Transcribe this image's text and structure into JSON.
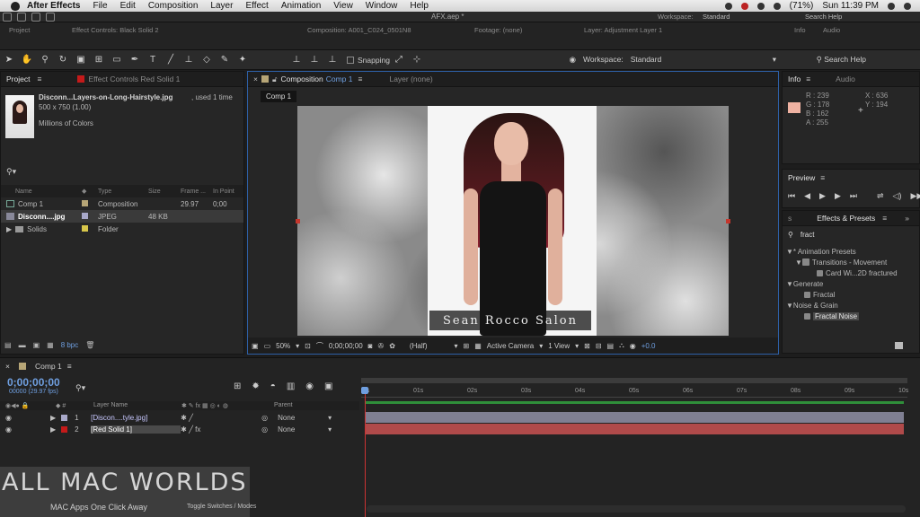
{
  "menubar": {
    "app": "After Effects",
    "items": [
      "File",
      "Edit",
      "Composition",
      "Layer",
      "Effect",
      "Animation",
      "View",
      "Window",
      "Help"
    ],
    "battery": "(71%)",
    "clock": "Sun 11:39 PM"
  },
  "oldbar": {
    "title": "AFX.aep *",
    "workspace_label": "Workspace:",
    "workspace_value": "Standard",
    "search": "Search Help",
    "tabs": [
      "Project",
      "Effect Controls: Black Solid 2",
      "Composition: A001_C024_0501N8",
      "Footage: (none)",
      "Layer: Adjustment Layer 1",
      "Info",
      "Audio"
    ]
  },
  "toolbar": {
    "snapping": "Snapping",
    "workspace_label": "Workspace:",
    "workspace_value": "Standard",
    "search_help": "Search Help"
  },
  "project": {
    "tab": "Project",
    "effect_tab": "Effect Controls Red Solid 1",
    "file_name": "Disconn...Layers-on-Long-Hairstyle.jpg",
    "used": ", used 1 time",
    "dims": "500 x 750 (1.00)",
    "colors": "Millions of Colors",
    "columns": [
      "Name",
      "Type",
      "Size",
      "Frame ...",
      "In Point"
    ],
    "rows": [
      {
        "name": "Comp 1",
        "type": "Composition",
        "size": "",
        "frame": "29.97",
        "in": "0;00",
        "color": "#b7a677"
      },
      {
        "name": "Disconn....jpg",
        "type": "JPEG",
        "size": "48 KB",
        "frame": "",
        "in": "",
        "color": "#a9a9c9"
      },
      {
        "name": "Solids",
        "type": "Folder",
        "size": "",
        "frame": "",
        "in": "",
        "color": "#d7c64a"
      }
    ],
    "bpc": "8 bpc"
  },
  "comp": {
    "tab": "Composition",
    "tab_comp": "Comp 1",
    "layer_tab": "Layer (none)",
    "breadcrumb": "Comp 1",
    "salon": "Sean Rocco Salon",
    "zoom": "50%",
    "timecode": "0;00;00;00",
    "resolution": "(Half)",
    "camera": "Active Camera",
    "view": "1 View",
    "exposure": "+0.0"
  },
  "info": {
    "tab": "Info",
    "audio_tab": "Audio",
    "r": "R : 239",
    "g": "G : 178",
    "b": "B : 162",
    "a": "A : 255",
    "x": "X : 636",
    "y": "Y : 194",
    "swatch": "#efb2a2"
  },
  "preview": {
    "title": "Preview"
  },
  "effects": {
    "title": "Effects & Presets",
    "search": "fract",
    "tree": [
      {
        "label": "* Animation Presets",
        "indent": 0
      },
      {
        "label": "Transitions - Movement",
        "indent": 1
      },
      {
        "label": "Card Wi...2D fractured",
        "indent": 2
      },
      {
        "label": "Generate",
        "indent": 0
      },
      {
        "label": "Fractal",
        "indent": 1
      },
      {
        "label": "Noise & Grain",
        "indent": 0
      },
      {
        "label": "Fractal Noise",
        "indent": 1
      }
    ]
  },
  "timeline": {
    "tab": "Comp 1",
    "timecode": "0;00;00;00",
    "fps": "00000 (29.97 fps)",
    "layer_col": "Layer Name",
    "parent_col": "Parent",
    "ruler": [
      "0s",
      "01s",
      "02s",
      "03s",
      "04s",
      "05s",
      "06s",
      "07s",
      "08s",
      "09s",
      "10s"
    ],
    "layers": [
      {
        "num": "1",
        "name": "[Discon....tyle.jpg]",
        "parent": "None",
        "color": "#a9a9c9"
      },
      {
        "num": "2",
        "name": "[Red Solid 1]",
        "parent": "None",
        "color": "#c41a1a"
      }
    ],
    "toggle": "Toggle Switches / Modes"
  },
  "watermark": {
    "title": "ALL MAC WORLDS",
    "subtitle": "MAC Apps One Click Away"
  }
}
